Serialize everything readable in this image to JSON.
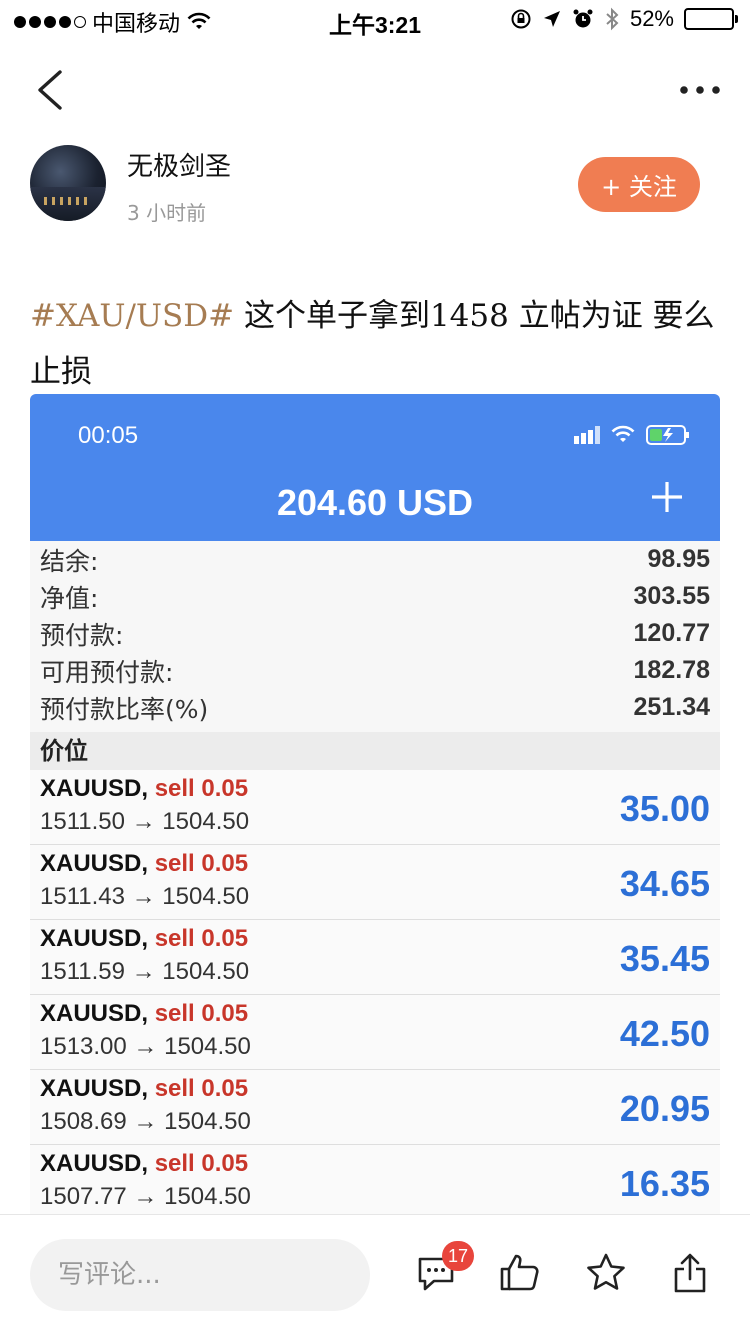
{
  "status_bar": {
    "carrier": "中国移动",
    "time": "上午3:21",
    "battery": "52%",
    "battery_level": 0.52
  },
  "author": {
    "name": "无极剑圣",
    "time_ago": "3 小时前",
    "follow_label": "+ 关注"
  },
  "post": {
    "tag": "#XAU/USD#",
    "text": " 这个单子拿到1458 立帖为证 要么止损"
  },
  "screenshot": {
    "status_time": "00:05",
    "balance_title": "204.60 USD",
    "summary": [
      {
        "label": "结余:",
        "value": "98.95"
      },
      {
        "label": "净值:",
        "value": "303.55"
      },
      {
        "label": "预付款:",
        "value": "120.77"
      },
      {
        "label": "可用预付款:",
        "value": "182.78"
      },
      {
        "label": "预付款比率(%)",
        "value": "251.34"
      }
    ],
    "section_title": "价位",
    "positions": [
      {
        "symbol": "XAUUSD,",
        "side": "sell 0.05",
        "prices": "1511.50 → 1504.50",
        "profit": "35.00"
      },
      {
        "symbol": "XAUUSD,",
        "side": "sell 0.05",
        "prices": "1511.43 → 1504.50",
        "profit": "34.65"
      },
      {
        "symbol": "XAUUSD,",
        "side": "sell 0.05",
        "prices": "1511.59 → 1504.50",
        "profit": "35.45"
      },
      {
        "symbol": "XAUUSD,",
        "side": "sell 0.05",
        "prices": "1513.00 → 1504.50",
        "profit": "42.50"
      },
      {
        "symbol": "XAUUSD,",
        "side": "sell 0.05",
        "prices": "1508.69 → 1504.50",
        "profit": "20.95"
      },
      {
        "symbol": "XAUUSD,",
        "side": "sell 0.05",
        "prices": "1507.77 → 1504.50",
        "profit": "16.35"
      }
    ]
  },
  "bottom_bar": {
    "comment_placeholder": "写评论...",
    "comment_count": "17",
    "icons": [
      "comment-icon",
      "like-icon",
      "favorite-icon",
      "share-icon"
    ]
  },
  "colors": {
    "accent_orange": "#f07d52",
    "tag_brown": "#a67c52",
    "header_blue": "#4a87ec",
    "profit_blue": "#2c6fd6",
    "sell_red": "#c8362a",
    "badge_red": "#e8453c"
  }
}
